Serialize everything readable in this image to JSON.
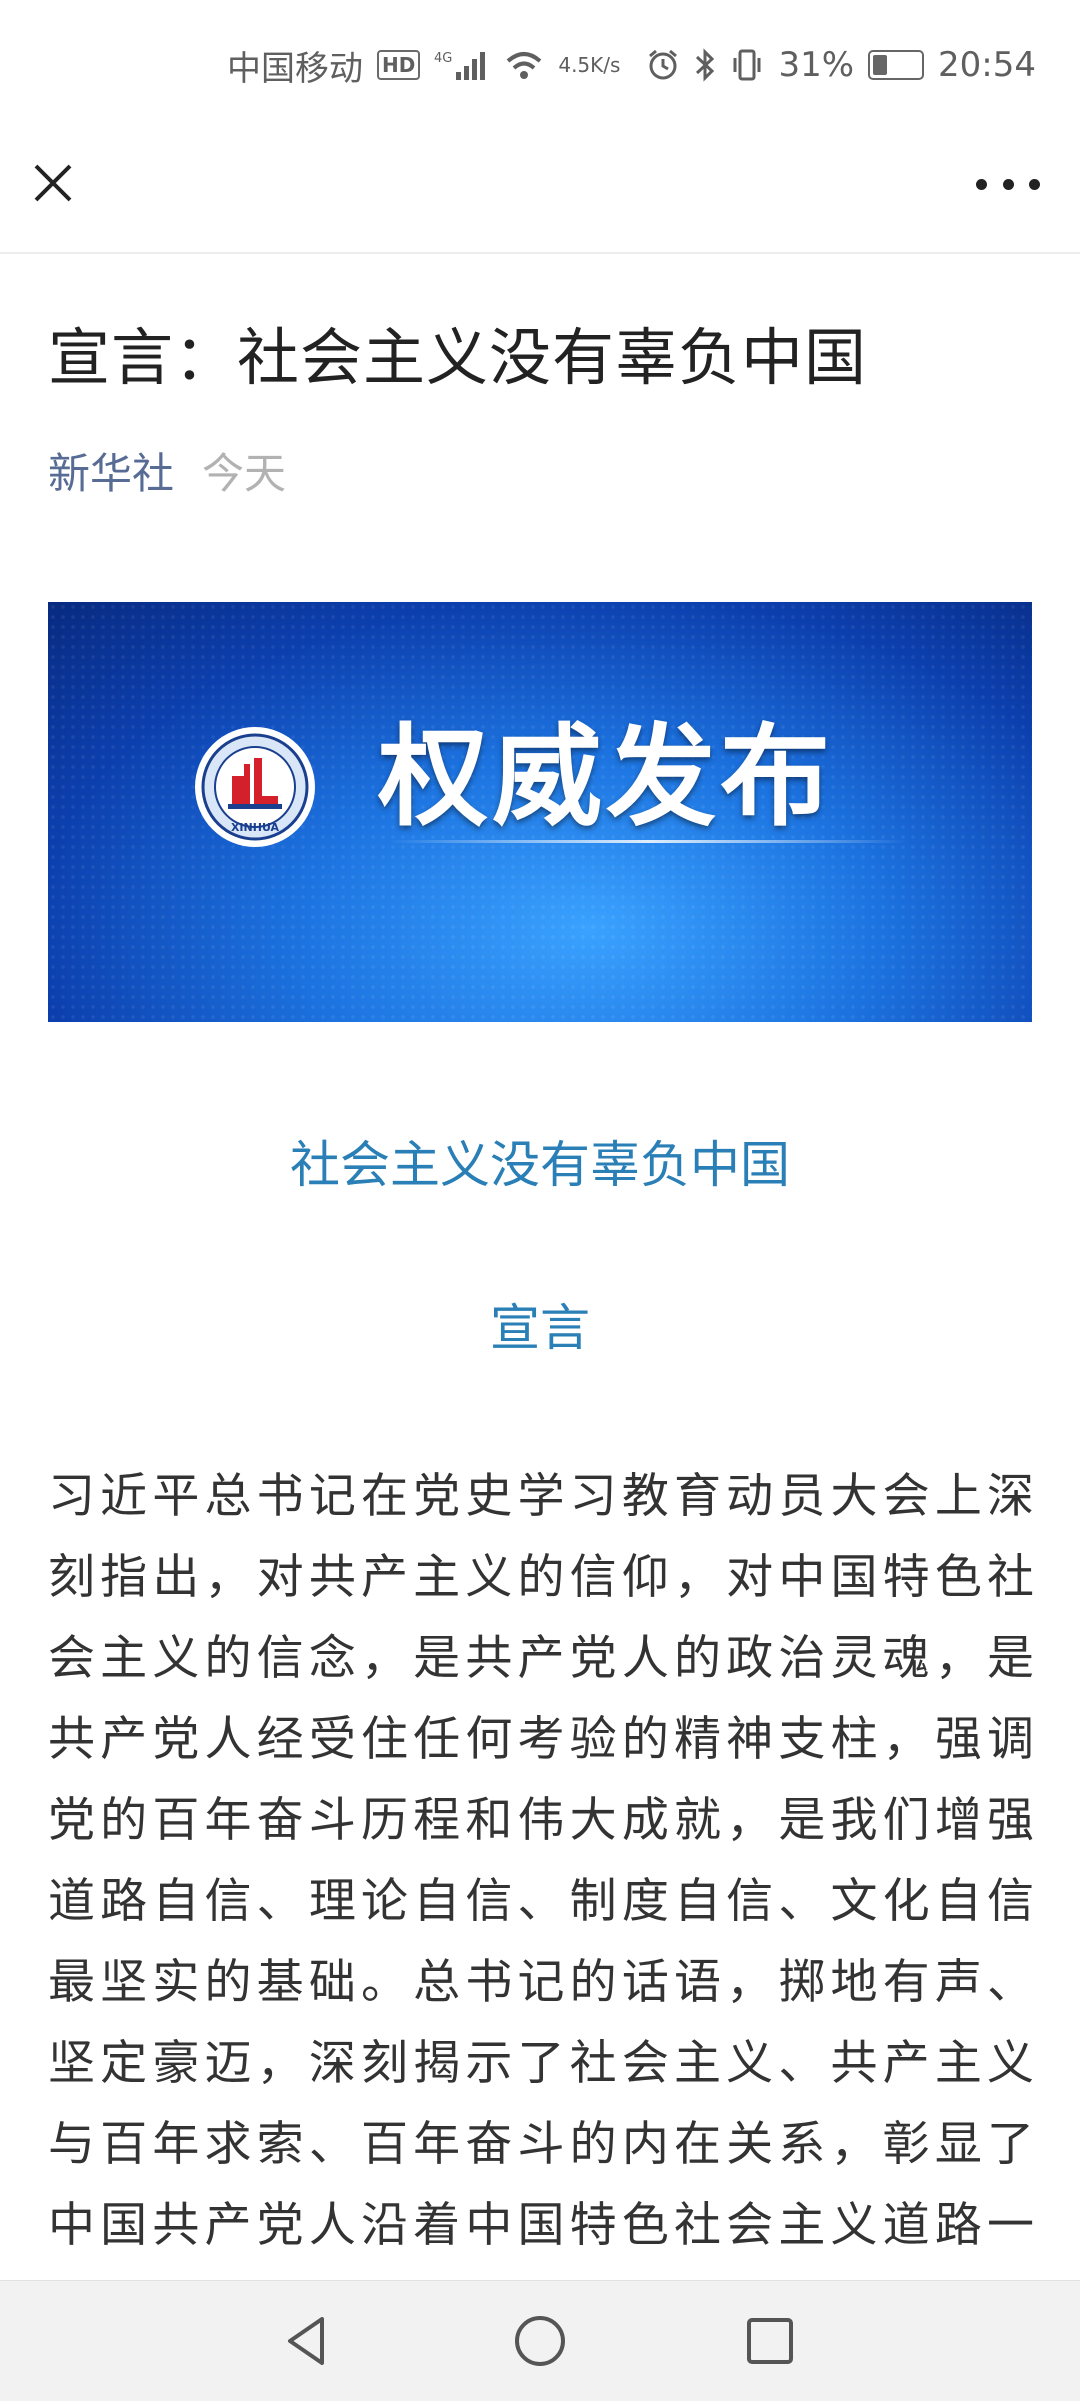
{
  "status_bar": {
    "carrier": "中国移动",
    "hd_badge": "HD",
    "network": "4G",
    "net_speed_value": "4.5",
    "net_speed_unit": "K/s",
    "battery": "31%",
    "time": "20:54"
  },
  "article": {
    "title": "宣言：社会主义没有辜负中国",
    "source": "新华社",
    "date": "今天",
    "banner_text": "权威发布",
    "banner_logo_text": "XINHUA",
    "subtitle": "社会主义没有辜负中国",
    "subtitle2": "宣言",
    "body": "习近平总书记在党史学习教育动员大会上深刻指出，对共产主义的信仰，对中国特色社会主义的信念，是共产党人的政治灵魂，是共产党人经受住任何考验的精神支柱，强调党的百年奋斗历程和伟大成就，是我们增强道路自信、理论自信、制度自信、文化自信最坚实的基础。总书记的话语，掷地有声、坚定豪迈，深刻揭示了社会主义、共产主义与百年求索、百年奋斗的内在关系，彰显了中国共产党人沿着中国特色社会主义道路一面路道路前进的"
  },
  "icons": {
    "close": "close-icon",
    "more": "more-icon",
    "back": "back-icon",
    "home": "home-icon",
    "recents": "recents-icon"
  },
  "colors": {
    "source_link": "#576b95",
    "subtitle": "#2a7fb6",
    "banner_blue": "#1c73e0"
  }
}
